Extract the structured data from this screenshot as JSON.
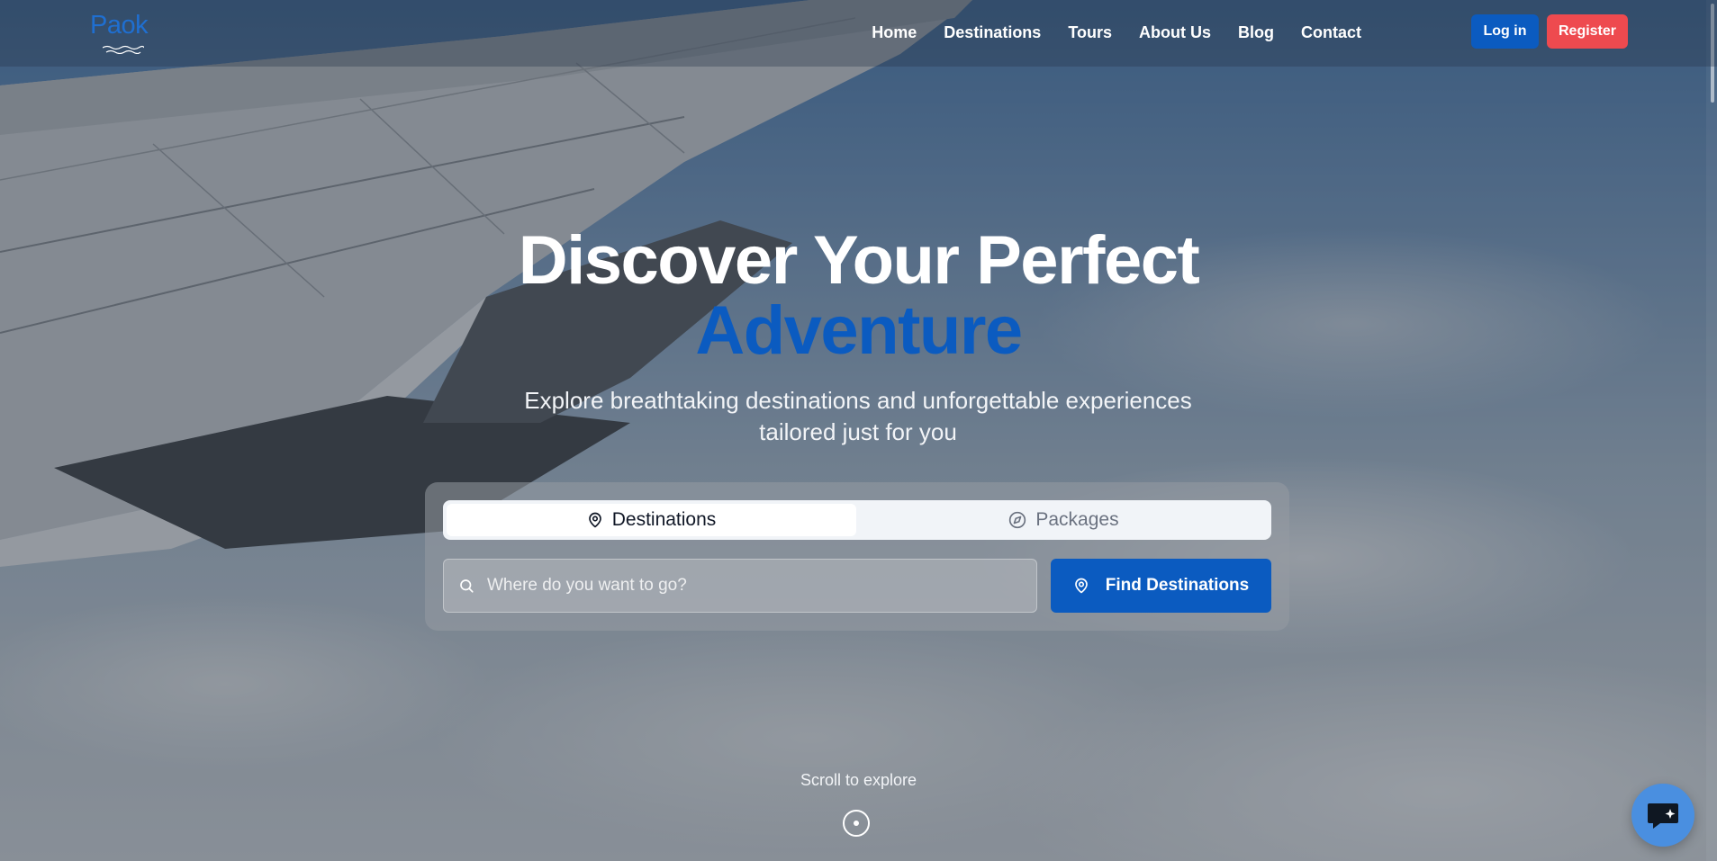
{
  "brand": {
    "logo_text": "Paok",
    "logo_color": "#1f6fd1",
    "accent_color": "#ee4a4f"
  },
  "nav": {
    "links": [
      "Home",
      "Destinations",
      "Tours",
      "About Us",
      "Blog",
      "Contact"
    ],
    "login_label": "Log in",
    "register_label": "Register",
    "login_color": "#0b5bc0",
    "register_color": "#ee4a4f"
  },
  "hero": {
    "title_line1": "Discover Your Perfect",
    "title_line2": "Adventure",
    "subtitle": "Explore breathtaking destinations and unforgettable experiences tailored just for you"
  },
  "search": {
    "tabs": [
      {
        "label": "Destinations",
        "icon": "map-pin-icon",
        "active": true
      },
      {
        "label": "Packages",
        "icon": "compass-icon",
        "active": false
      }
    ],
    "placeholder": "Where do you want to go?",
    "button_label": "Find Destinations",
    "button_icon": "map-pin-icon"
  },
  "scroll_hint": "Scroll to explore",
  "chat": {
    "icon": "chat-bubble-icon"
  }
}
